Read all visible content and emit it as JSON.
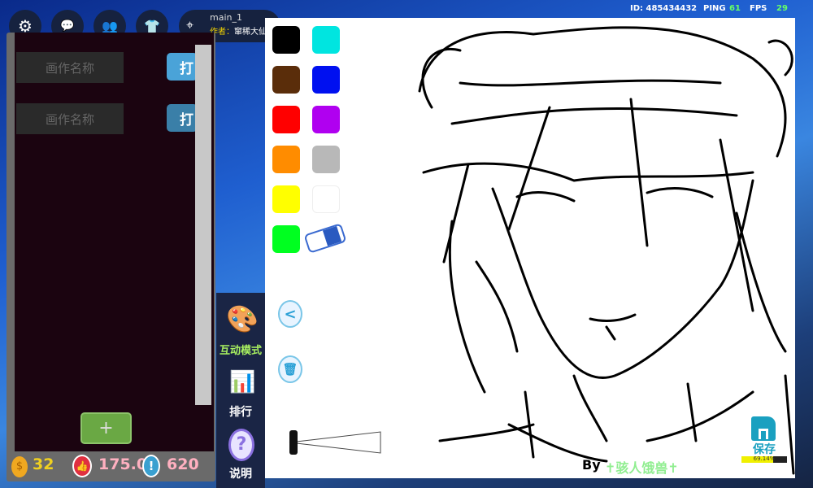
{
  "topbar": {
    "buttons": [
      "settings",
      "chat",
      "friends",
      "wardrobe"
    ],
    "room_name": "main_1",
    "author_label": "作者：",
    "author_name": "窜稀大仙"
  },
  "hud": {
    "id_label": "ID: 485434432",
    "ping_label": "PING",
    "ping": "61",
    "fps_label": "FPS",
    "fps": "29"
  },
  "works": [
    {
      "name_placeholder": "画作名称",
      "open_label": "打"
    },
    {
      "name_placeholder": "画作名称",
      "open_label": "打"
    }
  ],
  "add_label": "+",
  "stats": {
    "coins": "32",
    "likes": "175.0",
    "reports": "620"
  },
  "side": {
    "interactive_mode": "互动模式",
    "ranking": "排行",
    "help": "说明"
  },
  "palette": [
    "#000000",
    "#00e5e0",
    "#5a2d0a",
    "#0010f0",
    "#ff0000",
    "#b000f0",
    "#ff8c00",
    "#b8b8b8",
    "#ffff00",
    "#ffffff",
    "#00ff20"
  ],
  "canvas": {
    "by_label": "By",
    "author": "✝骇人饿兽✝",
    "save_label": "保存",
    "progress_text": "69.14%",
    "progress": 69.14
  }
}
